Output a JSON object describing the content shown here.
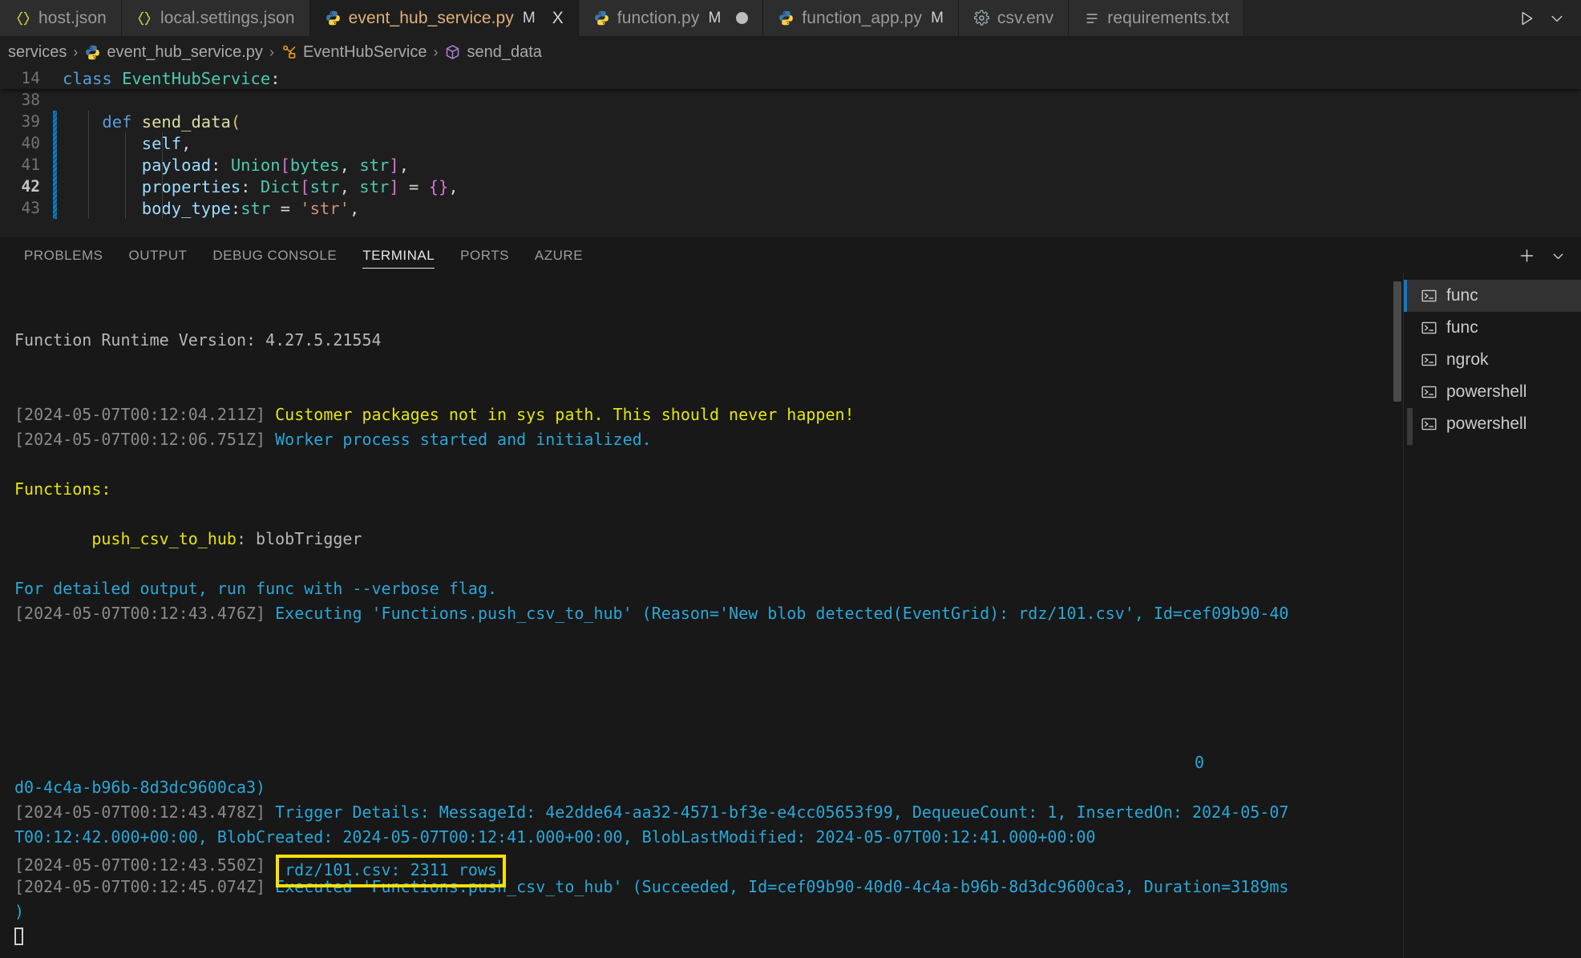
{
  "window": {
    "app": "Visual Studio Code",
    "theme_bg": "#1e1e1e",
    "accent": "#0a7aca",
    "highlight_color": "#ffe000"
  },
  "tabs": [
    {
      "label": "host.json",
      "icon": "json-braces-icon",
      "modified": "",
      "active": false,
      "dirty_dot": false,
      "closeable": false
    },
    {
      "label": "local.settings.json",
      "icon": "json-braces-icon",
      "modified": "",
      "active": false,
      "dirty_dot": false,
      "closeable": false
    },
    {
      "label": "event_hub_service.py",
      "icon": "python-icon",
      "modified": "M",
      "active": true,
      "dirty_dot": false,
      "closeable": true
    },
    {
      "label": "function.py",
      "icon": "python-icon",
      "modified": "M",
      "active": false,
      "dirty_dot": true,
      "closeable": false
    },
    {
      "label": "function_app.py",
      "icon": "python-icon",
      "modified": "M",
      "active": false,
      "dirty_dot": false,
      "closeable": false
    },
    {
      "label": "csv.env",
      "icon": "gear-icon",
      "modified": "",
      "active": false,
      "dirty_dot": false,
      "closeable": false
    },
    {
      "label": "requirements.txt",
      "icon": "list-lines-icon",
      "modified": "",
      "active": false,
      "dirty_dot": false,
      "closeable": false
    }
  ],
  "tabbar_actions": {
    "run_label": "run-play-icon",
    "more_label": "chevron-down-icon",
    "close_label": "X"
  },
  "breadcrumb": [
    {
      "label": "services",
      "icon": "folder-none"
    },
    {
      "label": "event_hub_service.py",
      "icon": "python-icon"
    },
    {
      "label": "EventHubService",
      "icon": "class-symbol-icon"
    },
    {
      "label": "send_data",
      "icon": "method-symbol-icon"
    }
  ],
  "breadcrumb_separator": "›",
  "editor": {
    "sticky": {
      "line_no": "14",
      "text": "class EventHubService:"
    },
    "lines": [
      {
        "line_no": "38",
        "text": ""
      },
      {
        "line_no": "39",
        "text": "    def send_data("
      },
      {
        "line_no": "40",
        "text": "        self,"
      },
      {
        "line_no": "41",
        "text": "        payload: Union[bytes, str],"
      },
      {
        "line_no": "42",
        "text": "        properties: Dict[str, str] = {},"
      },
      {
        "line_no": "43",
        "text": "        body_type:str = 'str',"
      }
    ],
    "current_line": "42"
  },
  "panel": {
    "tabs": [
      {
        "label": "PROBLEMS",
        "active": false
      },
      {
        "label": "OUTPUT",
        "active": false
      },
      {
        "label": "DEBUG CONSOLE",
        "active": false
      },
      {
        "label": "TERMINAL",
        "active": true
      },
      {
        "label": "PORTS",
        "active": false
      },
      {
        "label": "AZURE",
        "active": false
      }
    ],
    "actions": [
      {
        "name": "new-terminal-button",
        "label": "+"
      },
      {
        "name": "terminal-split-dropdown-button",
        "label": "⌄"
      }
    ]
  },
  "terminal": {
    "lines": [
      {
        "segments": [
          {
            "text": "Function Runtime Version: 4.27.5.21554",
            "color": "gray"
          }
        ]
      },
      {
        "segments": []
      },
      {
        "segments": []
      },
      {
        "segments": [
          {
            "text": "[2024-05-07T00:12:04.211Z] ",
            "color": "ts"
          },
          {
            "text": "Customer packages not in sys path. This should never happen!",
            "color": "yellow"
          }
        ]
      },
      {
        "segments": [
          {
            "text": "[2024-05-07T00:12:06.751Z] ",
            "color": "ts"
          },
          {
            "text": "Worker process started and initialized.",
            "color": "cyan"
          }
        ]
      },
      {
        "segments": []
      },
      {
        "segments": [
          {
            "text": "Functions:",
            "color": "yellow"
          }
        ]
      },
      {
        "segments": []
      },
      {
        "segments": [
          {
            "text": "        push_csv_to_hub",
            "color": "yellow"
          },
          {
            "text": ": blobTrigger",
            "color": "gray"
          }
        ]
      },
      {
        "segments": []
      },
      {
        "segments": [
          {
            "text": "For detailed output, run func with --verbose flag.",
            "color": "cyan"
          }
        ]
      },
      {
        "segments": [
          {
            "text": "[2024-05-07T00:12:43.476Z] ",
            "color": "ts"
          },
          {
            "text": "Executing 'Functions.push_csv_to_hub' (Reason='New blob detected(EventGrid): rdz/101.csv', Id=cef09b90-40",
            "color": "cyan"
          }
        ]
      },
      {
        "segments": []
      },
      {
        "segments": []
      },
      {
        "segments": []
      },
      {
        "segments": []
      },
      {
        "segments": []
      },
      {
        "segments": [
          {
            "text": "0",
            "color": "cyan",
            "align": "right"
          }
        ]
      },
      {
        "segments": [
          {
            "text": "d0-4c4a-b96b-8d3dc9600ca3)",
            "color": "cyan"
          }
        ]
      },
      {
        "segments": [
          {
            "text": "[2024-05-07T00:12:43.478Z] ",
            "color": "ts"
          },
          {
            "text": "Trigger Details: MessageId: 4e2dde64-aa32-4571-bf3e-e4cc05653f99, DequeueCount: 1, InsertedOn: 2024-05-07",
            "color": "cyan"
          }
        ]
      },
      {
        "segments": [
          {
            "text": "T00:12:42.000+00:00, BlobCreated: 2024-05-07T00:12:41.000+00:00, BlobLastModified: 2024-05-07T00:12:41.000+00:00",
            "color": "cyan"
          }
        ]
      },
      {
        "segments": [
          {
            "text": "[2024-05-07T00:12:43.550Z] ",
            "color": "ts"
          },
          {
            "text": "rdz/101.csv: 2311 rows",
            "color": "cyan",
            "boxed": true
          }
        ]
      },
      {
        "segments": [
          {
            "text": "[2024-05-07T00:12:45.074Z] ",
            "color": "ts"
          },
          {
            "text": "Executed 'Functions.push_csv_to_hub' (Succeeded, Id=cef09b90-40d0-4c4a-b96b-8d3dc9600ca3, Duration=3189ms",
            "color": "cyan"
          }
        ]
      },
      {
        "segments": [
          {
            "text": ")",
            "color": "cyan"
          }
        ]
      },
      {
        "segments": [
          {
            "text": "",
            "color": "cyan",
            "cursor": true
          }
        ]
      }
    ]
  },
  "terminal_list": [
    {
      "label": "func",
      "icon": "terminal-icon",
      "active": true
    },
    {
      "label": "func",
      "icon": "terminal-icon",
      "active": false
    },
    {
      "label": "ngrok",
      "icon": "terminal-icon",
      "active": false
    },
    {
      "label": "powershell",
      "icon": "terminal-icon",
      "active": false
    },
    {
      "label": "powershell",
      "icon": "terminal-icon",
      "active": false
    }
  ]
}
